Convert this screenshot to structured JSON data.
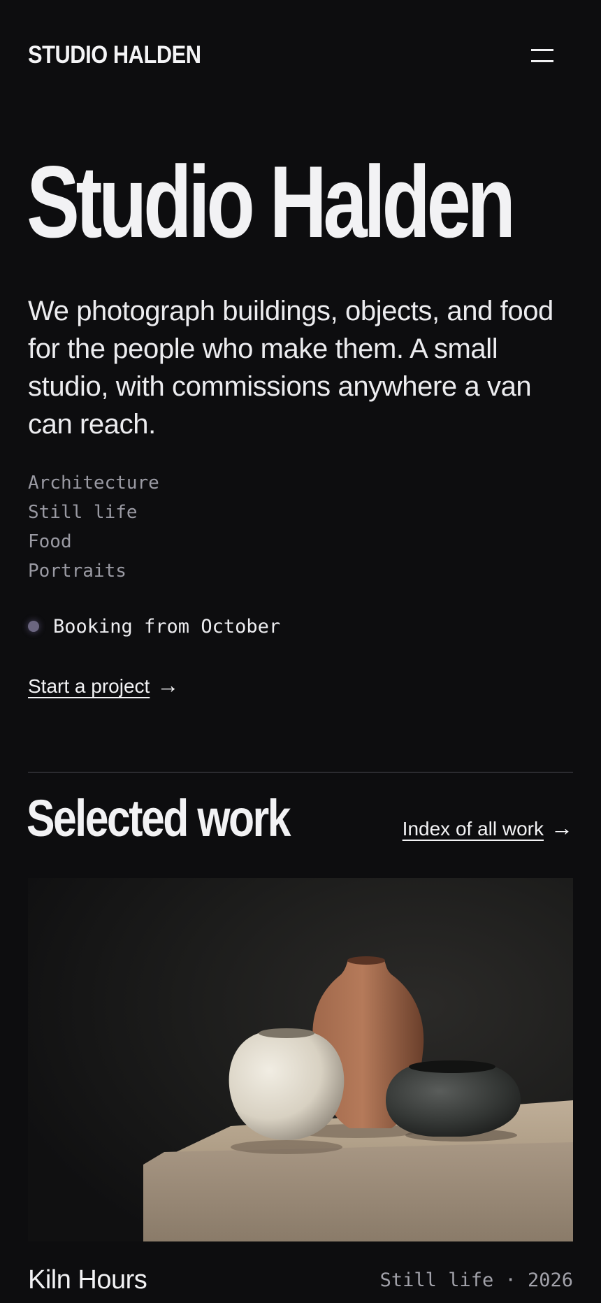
{
  "header": {
    "brand": "STUDIO HALDEN",
    "menu_icon": "hamburger-menu-icon"
  },
  "hero": {
    "title": "Studio Halden",
    "lede": "We photograph buildings, objects, and food for the people who make them. A small studio, with commissions anywhere a van can reach.",
    "services": [
      "Architecture",
      "Still life",
      "Food",
      "Portraits"
    ],
    "booking": {
      "text": "Booking from October",
      "dot_color": "#6b6680"
    },
    "cta": {
      "label": "Start a project",
      "arrow": "→"
    }
  },
  "work": {
    "heading": "Selected work",
    "index_link": {
      "label": "Index of all work",
      "arrow": "→"
    },
    "featured": {
      "image_icon": "ceramic-vessels-photo",
      "title": "Kiln Hours",
      "tags": "Still life · 2026"
    }
  },
  "colors": {
    "background": "#0d0d0f",
    "text": "#f2f2f4",
    "muted": "#9a9aa3",
    "divider": "#2b2b30"
  }
}
